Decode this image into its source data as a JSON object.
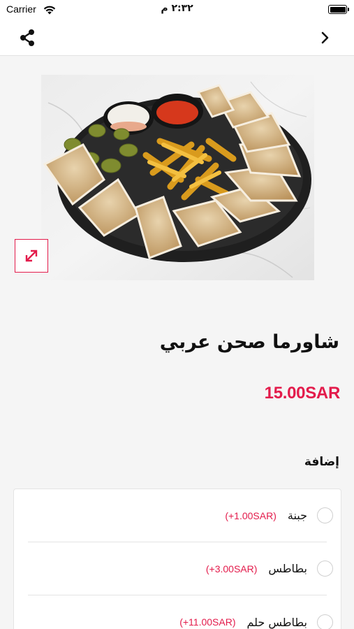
{
  "status_bar": {
    "carrier": "Carrier",
    "time": "٢:٣٢ م"
  },
  "nav": {
    "share_icon": "share-icon",
    "back_icon": "chevron-right-icon"
  },
  "product": {
    "image_alt": "shawarma-plate-image",
    "expand_icon": "expand-arrows-icon",
    "title": "شاورما صحن عربي",
    "price": "15.00SAR"
  },
  "addons": {
    "title": "إضافة",
    "options": [
      {
        "name": "جبنة",
        "price": "(+1.00SAR)"
      },
      {
        "name": "بطاطس",
        "price": "(+3.00SAR)"
      },
      {
        "name": "بطاطس حلم",
        "price": "(+11.00SAR)"
      }
    ]
  },
  "colors": {
    "accent": "#e31b4b",
    "background": "#f5f5f5"
  }
}
